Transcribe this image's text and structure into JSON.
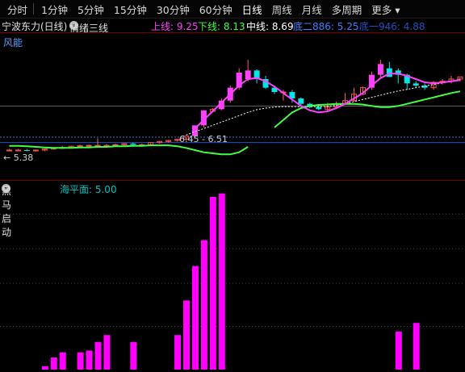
{
  "toolbar": {
    "items": [
      "分时",
      "1分钟",
      "5分钟",
      "15分钟",
      "30分钟",
      "60分钟",
      "日线",
      "周线",
      "月线",
      "多周期",
      "更多"
    ],
    "active_index": 6
  },
  "header": {
    "stock": "宁波东力(日线)",
    "indicator": "情绪三线",
    "shang_label": "上线: 9.25",
    "xia_label": "下线: 8.13",
    "zhong_label": "中线: 8.69",
    "di2_label": "底二886: 5.25",
    "di1_label": "底一946: 4.88",
    "colors": {
      "shang": "#ff40ff",
      "xia": "#40ff40",
      "zhong": "#ffffff",
      "di2": "#4080ff",
      "di1": "#2050c0"
    }
  },
  "fengneng": "风能",
  "annotations": {
    "low_price": "5.38",
    "mid_marker": "6.45 - 6.51"
  },
  "sub": {
    "indicator": "黑马启动",
    "sea_level": "海平面: 5.00",
    "colors": {
      "bar": "#ff00ff",
      "sea": "#00c0c0"
    }
  },
  "chart_data": [
    {
      "type": "candlestick",
      "title": "宁波东力(日线)",
      "ylim": [
        4.5,
        10.8
      ],
      "series": [
        {
          "name": "open",
          "values": [
            5.4,
            5.4,
            5.4,
            5.38,
            5.4,
            5.45,
            5.5,
            5.52,
            5.58,
            5.6,
            5.62,
            5.6,
            5.62,
            5.65,
            5.7,
            5.65,
            5.65,
            5.75,
            5.8,
            5.85,
            5.9,
            6.05,
            6.55,
            7.2,
            7.3,
            7.7,
            8.3,
            8.7,
            9.1,
            8.7,
            8.3,
            8.1,
            8.1,
            7.8,
            7.55,
            7.4,
            7.3,
            7.4,
            7.55,
            7.7,
            8.0,
            8.3,
            8.9,
            9.2,
            9.1,
            8.9,
            8.5,
            8.4,
            8.3,
            8.55,
            8.6,
            8.7
          ]
        },
        {
          "name": "high",
          "values": [
            5.45,
            5.45,
            5.45,
            5.43,
            5.45,
            5.5,
            5.6,
            5.6,
            5.65,
            5.65,
            5.95,
            5.68,
            5.7,
            5.72,
            5.75,
            5.7,
            5.72,
            5.8,
            5.85,
            5.9,
            6.0,
            6.15,
            7.25,
            7.35,
            7.8,
            8.4,
            9.2,
            9.6,
            9.15,
            8.85,
            8.4,
            8.2,
            8.2,
            7.85,
            7.6,
            7.5,
            7.6,
            7.65,
            8.05,
            8.3,
            8.35,
            9.05,
            9.6,
            9.5,
            9.2,
            8.95,
            8.6,
            8.5,
            8.6,
            8.7,
            8.85,
            8.75
          ]
        },
        {
          "name": "low",
          "values": [
            5.35,
            5.35,
            5.35,
            5.33,
            5.35,
            5.42,
            5.45,
            5.48,
            5.52,
            5.55,
            5.58,
            5.55,
            5.58,
            5.6,
            5.62,
            5.6,
            5.6,
            5.7,
            5.75,
            5.8,
            5.85,
            5.95,
            6.45,
            7.15,
            7.25,
            7.6,
            8.2,
            8.6,
            8.5,
            8.25,
            8.0,
            7.7,
            7.6,
            7.5,
            7.35,
            7.25,
            7.2,
            7.3,
            7.5,
            7.65,
            7.95,
            8.2,
            8.8,
            8.8,
            8.5,
            8.2,
            8.3,
            8.2,
            8.2,
            8.45,
            8.5,
            8.6
          ]
        },
        {
          "name": "close",
          "values": [
            5.4,
            5.4,
            5.38,
            5.4,
            5.45,
            5.5,
            5.52,
            5.58,
            5.6,
            5.62,
            5.62,
            5.62,
            5.65,
            5.7,
            5.65,
            5.65,
            5.75,
            5.8,
            5.85,
            5.9,
            6.05,
            6.55,
            7.25,
            7.3,
            7.7,
            8.3,
            9.0,
            9.1,
            8.7,
            8.3,
            8.1,
            8.1,
            7.8,
            7.55,
            7.4,
            7.3,
            7.4,
            7.55,
            7.7,
            8.0,
            8.3,
            8.9,
            9.4,
            8.8,
            8.9,
            8.5,
            8.4,
            8.3,
            8.55,
            8.6,
            8.7,
            8.8
          ]
        },
        {
          "name": "上线",
          "values": [
            null,
            null,
            null,
            null,
            null,
            null,
            null,
            null,
            null,
            null,
            null,
            null,
            null,
            null,
            null,
            null,
            null,
            null,
            null,
            null,
            null,
            6.4,
            6.8,
            7.2,
            7.6,
            8.0,
            8.4,
            8.7,
            8.75,
            8.6,
            8.35,
            8.05,
            7.75,
            7.45,
            7.25,
            7.15,
            7.2,
            7.35,
            7.55,
            7.8,
            8.05,
            8.4,
            8.75,
            8.95,
            8.95,
            8.85,
            8.7,
            8.55,
            8.5,
            8.55,
            8.6,
            8.65
          ]
        },
        {
          "name": "中线",
          "values": [
            null,
            null,
            null,
            null,
            null,
            null,
            null,
            null,
            null,
            null,
            null,
            null,
            null,
            null,
            null,
            null,
            null,
            null,
            null,
            null,
            6.1,
            6.25,
            6.4,
            6.55,
            6.7,
            6.85,
            7.0,
            7.15,
            7.28,
            7.35,
            7.4,
            7.42,
            7.42,
            7.42,
            7.42,
            7.42,
            7.43,
            7.48,
            7.55,
            7.65,
            7.75,
            7.85,
            7.95,
            8.05,
            8.15,
            8.22,
            8.3,
            8.38,
            8.45,
            8.52,
            8.6,
            8.69
          ]
        },
        {
          "name": "下线",
          "values": [
            5.6,
            5.6,
            5.58,
            5.55,
            5.52,
            5.5,
            5.5,
            5.5,
            5.52,
            5.52,
            5.55,
            5.55,
            5.58,
            5.58,
            5.6,
            5.6,
            5.62,
            5.62,
            5.62,
            5.58,
            5.5,
            5.4,
            5.3,
            5.25,
            5.2,
            5.2,
            5.3,
            5.55,
            null,
            null,
            6.45,
            6.8,
            7.15,
            7.35,
            7.45,
            7.5,
            7.52,
            7.55,
            7.55,
            7.55,
            7.52,
            7.45,
            7.4,
            7.4,
            7.45,
            7.55,
            7.65,
            7.75,
            7.85,
            7.95,
            8.05,
            8.13
          ]
        }
      ]
    },
    {
      "type": "bar",
      "title": "黑马启动",
      "ylim": [
        0,
        100
      ],
      "values": [
        0,
        0,
        0,
        0,
        2,
        7,
        10,
        0,
        10,
        11,
        16,
        20,
        0,
        0,
        16,
        0,
        0,
        0,
        0,
        20,
        40,
        60,
        75,
        100,
        102,
        0,
        0,
        0,
        0,
        0,
        0,
        0,
        0,
        0,
        0,
        0,
        0,
        0,
        0,
        0,
        0,
        0,
        0,
        0,
        22,
        0,
        27,
        0,
        0,
        0,
        0,
        0
      ]
    }
  ]
}
